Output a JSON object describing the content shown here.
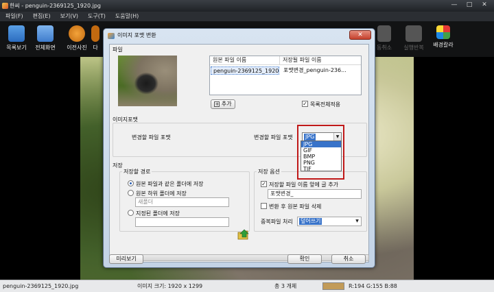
{
  "window": {
    "title": "한씨 - penguin-2369125_1920.jpg",
    "minimize": "—",
    "maximize": "□",
    "close": "✕"
  },
  "menu": [
    "파일(F)",
    "편집(E)",
    "보기(V)",
    "도구(T)",
    "도움말(H)"
  ],
  "toolbar": {
    "list_view": "목록보기",
    "full_screen": "전체화면",
    "prev_photo": "이전사진",
    "next_photo_partial": "다",
    "undo": "동취소",
    "redo": "실행반복",
    "bg_color": "배경칼라"
  },
  "status": {
    "filename": "penguin-2369125_1920.jpg",
    "image_size": "이미지 크기: 1920 x 1299",
    "count": "총 3 개체",
    "rgb": "R:194 G:155 B:88",
    "color_hex": "#c29b58"
  },
  "dialog": {
    "title": "이미지 포맷 변환",
    "close": "✕",
    "file_section": "파일",
    "col_original": "원본 파일 이름",
    "col_saved": "저장될 파일 이름",
    "original_name": "penguin-2369125_1920....",
    "saved_name": "포맷변경_penguin-236...",
    "add_button": "추가",
    "apply_all": "목록전체적용",
    "format_section": "이미지포맷",
    "change_format_label_left": "변경할 파일 포맷",
    "change_format_label_right": "변경할 파일 포맷",
    "format_selected": "JPG",
    "format_options": [
      "JPG",
      "GIF",
      "BMP",
      "PNG",
      "TIF"
    ],
    "save_section": "저장",
    "save_path_title": "저장할 경로",
    "opt_same_folder": "원본 파일과 같은 폴더에 저장",
    "opt_sub_folder": "원본 하위 폴더에 저장",
    "sub_folder_value": "새폴더",
    "opt_custom_folder": "지정된 폴더에 저장",
    "custom_folder_value": "",
    "save_options_title": "저장 옵션",
    "opt_prefix": "저장할 파일 이름 앞에 글 추가",
    "prefix_value": "포맷변경_",
    "opt_delete_original": "변환 후 원본 파일 삭제",
    "dup_label": "중복파일 처리",
    "dup_value": "덮어쓰기",
    "preview_button": "미리보기",
    "ok_button": "확인",
    "cancel_button": "취소"
  }
}
